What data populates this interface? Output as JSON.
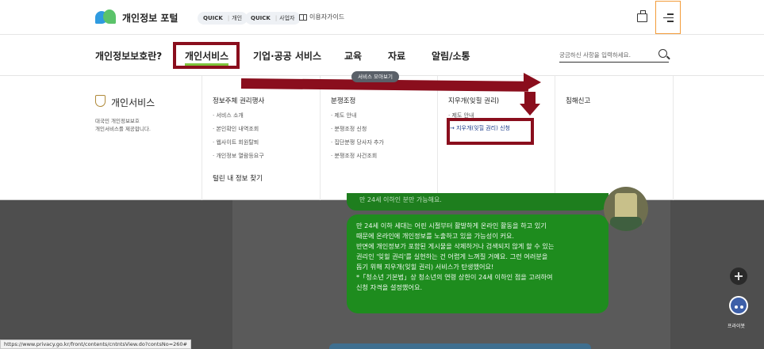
{
  "header": {
    "logo_text": "개인정보 포털",
    "quick_personal": {
      "prefix": "QUICK",
      "label": "개인"
    },
    "quick_business": {
      "prefix": "QUICK",
      "label": "사업자"
    },
    "user_guide": "이용자가이드"
  },
  "nav": {
    "items": [
      "개인정보보호란?",
      "개인서비스",
      "기업·공공 서비스",
      "교육",
      "자료",
      "알림/소통"
    ],
    "active": "개인서비스",
    "search_placeholder": "궁금하신 사항을 입력하세요."
  },
  "dropdown": {
    "title": "개인서비스",
    "description": [
      "대국민 개인정보보호",
      "개인서비스를 제공합니다."
    ],
    "sitemap_button": "서비스 모아보기",
    "columns": [
      {
        "heading": "정보주체 권리행사",
        "links": [
          "· 서비스 소개",
          "· 본인확인 내역조회",
          "· 웹사이트 회원탈퇴",
          "· 개인정보 열람등요구"
        ],
        "heading2": "털린 내 정보 찾기"
      },
      {
        "heading": "분쟁조정",
        "links": [
          "· 제도 안내",
          "· 분쟁조정 신청",
          "· 집단분쟁 당사자 추가",
          "· 분쟁조정 사건조회"
        ]
      },
      {
        "heading": "지우개(잊힐 권리)",
        "links": [
          "· 제도 안내",
          "→ 지우개(잊힐 권리) 신청"
        ]
      },
      {
        "heading": "침해신고",
        "links": []
      }
    ]
  },
  "chat": {
    "top_text": "만 24세 이하인 분만 가능해요.",
    "lines": [
      "만 24세 이하 세대는 어린 시절부터 활발하게 온라인 활동을 하고 있기",
      "때문에 온라인에 개인정보를 노출하고 있을 가능성이 커요.",
      "반면에 개인정보가 포함된 게시물을 삭제하거나 검색되지 않게 할 수 있는",
      "권리인 '잊힐 권리'를 실현하는 건 어렵게 느껴질 거예요. 그런 여러분을",
      "돕기 위해 지우개(잊힐 권리) 서비스가 탄생했어요!",
      "*「청소년 기본법」상 청소년의 연령 상한이 24세 이하인 점을 고려하여",
      "신청 자격을 설정했어요."
    ]
  },
  "pribot_label": "프라이봇",
  "status_url": "https://www.privacy.go.kr/front/contents/cntntsView.do?contsNo=260#",
  "colors": {
    "annotation": "#8a0e1d",
    "accent_green": "#7ec33b",
    "bubble": "#1e8c1e"
  }
}
